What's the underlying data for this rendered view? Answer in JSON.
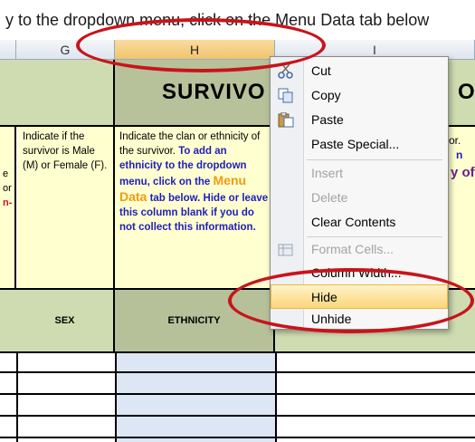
{
  "instruction_text": "y to the dropdown menu, click on the Menu Data tab below",
  "columns": [
    {
      "letter": "G",
      "selected": false
    },
    {
      "letter": "H",
      "selected": true
    },
    {
      "letter": "I",
      "selected": false
    }
  ],
  "banner_title": "SURVIVO",
  "banner_right_fragment": "O",
  "left_edge_fragments": [
    "e",
    "or",
    "n-"
  ],
  "sex_description": "Indicate if the survivor is Male (M) or Female (F).",
  "ethnicity_description": {
    "plain": "Indicate the clan or ethnicity of the survivor.",
    "blue_before": "To add an ethnicity to the dropdown menu, click on the",
    "orange": "Menu Data",
    "blue_after": "tab below. Hide or leave this column blank if you do not collect this information."
  },
  "right_description_fragments": [
    "or.",
    "n",
    "y of"
  ],
  "headers": {
    "sex": "SEX",
    "ethnicity": "ETHNICITY"
  },
  "context_menu": {
    "items": [
      {
        "label": "Cut",
        "icon": "scissors-icon",
        "enabled": true
      },
      {
        "label": "Copy",
        "icon": "copy-icon",
        "enabled": true
      },
      {
        "label": "Paste",
        "icon": "paste-icon",
        "enabled": true
      },
      {
        "label": "Paste Special...",
        "icon": "",
        "enabled": true
      },
      {
        "label": "Insert",
        "icon": "",
        "enabled": false
      },
      {
        "label": "Delete",
        "icon": "",
        "enabled": false
      },
      {
        "label": "Clear Contents",
        "icon": "",
        "enabled": true
      },
      {
        "label": "Format Cells...",
        "icon": "format-cells-icon",
        "enabled": false
      },
      {
        "label": "Column Width...",
        "icon": "",
        "enabled": true
      },
      {
        "label": "Hide",
        "icon": "",
        "enabled": true,
        "highlighted": true
      },
      {
        "label": "Unhide",
        "icon": "",
        "enabled": true
      }
    ]
  },
  "colors": {
    "annotation_oval": "#c8141b",
    "header_green": "#cfdcb1",
    "note_yellow": "#ffffd0",
    "menu_highlight": "#fbd57a"
  }
}
